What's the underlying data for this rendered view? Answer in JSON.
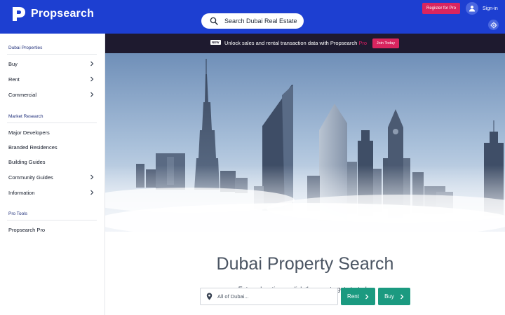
{
  "brand": {
    "name": "Propsearch"
  },
  "header": {
    "search_placeholder": "Search Dubai Real Estate",
    "register_label": "Register for Pro",
    "signin_label": "Sign-in"
  },
  "sidebar": {
    "sections": [
      {
        "heading": "Dubai Properties",
        "items": [
          {
            "label": "Buy",
            "chevron": true
          },
          {
            "label": "Rent",
            "chevron": true
          },
          {
            "label": "Commercial",
            "chevron": true
          }
        ]
      },
      {
        "heading": "Market Research",
        "items": [
          {
            "label": "Major Developers",
            "chevron": false
          },
          {
            "label": "Branded Residences",
            "chevron": false
          },
          {
            "label": "Building Guides",
            "chevron": false
          },
          {
            "label": "Community Guides",
            "chevron": true
          },
          {
            "label": "Information",
            "chevron": true
          }
        ]
      },
      {
        "heading": "Pro Tools",
        "items": [
          {
            "label": "Propsearch Pro",
            "chevron": false
          }
        ]
      }
    ]
  },
  "promo": {
    "badge": "NEW",
    "text": "Unlock sales and rental transaction data with Propsearch",
    "pro": "Pro",
    "cta": "Join Today"
  },
  "hero": {
    "title": "Dubai Property Search",
    "subtitle": "Enter a location or click the map to get started...",
    "location_placeholder": "All of Dubai...",
    "rent_label": "Rent",
    "buy_label": "Buy"
  },
  "colors": {
    "header_blue": "#1d3fd1",
    "accent_pink": "#d9255f",
    "button_green": "#1b9a80",
    "promo_dark": "#1e1a2f"
  },
  "icons": {
    "logo": "propsearch-p-logo",
    "search": "search-icon",
    "user": "user-icon",
    "settings": "settings-icon",
    "chevron": "chevron-right-icon",
    "location": "map-pin-icon"
  }
}
